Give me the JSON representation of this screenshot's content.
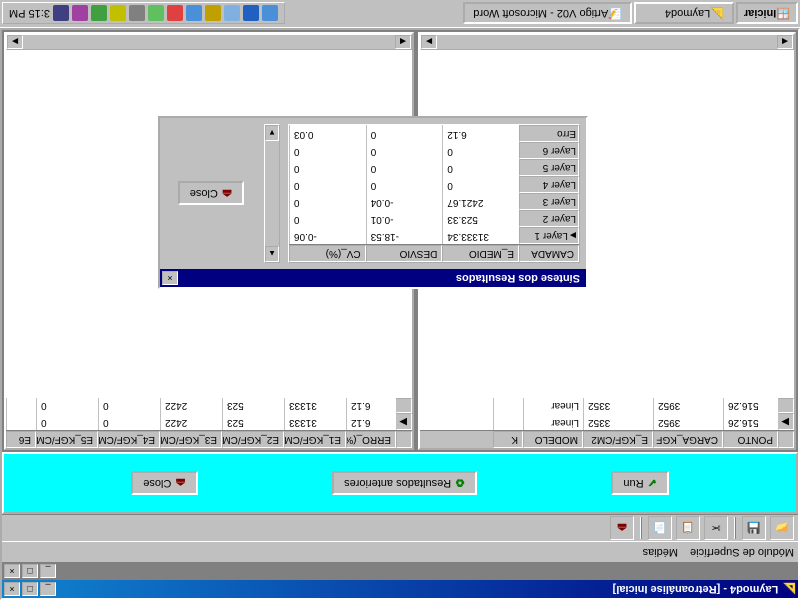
{
  "taskbar": {
    "start": "Iniciar",
    "tasks": [
      {
        "label": "Laymod4",
        "active": true
      },
      {
        "label": "Artigo V02 - Microsoft Word",
        "active": false
      }
    ],
    "clock": "3:15 PM"
  },
  "app": {
    "title": "Laymod4 - [Retroanálise Inicial]",
    "menu": [
      "Módulo de Superfície",
      "Médias"
    ],
    "action_panel": {
      "run": "Run",
      "prev_results": "Resultados anteriores",
      "close": "Close"
    },
    "left_grid": {
      "headers": [
        "PONTO",
        "CARGA_KGF",
        "E_KGF/CM2",
        "MODELO",
        "K"
      ],
      "rows": [
        [
          "516.26",
          "3952",
          "3352",
          "Linear",
          ""
        ],
        [
          "516.26",
          "3952",
          "3352",
          "Linear",
          ""
        ]
      ]
    },
    "right_grid": {
      "headers": [
        "ERRO_(%)",
        "E1_KGF/CM2",
        "E2_KGF/CM2",
        "E3_KGF/CM2",
        "E4_KGF/CM2",
        "E5_KGF/CM2",
        "E6"
      ],
      "rows": [
        [
          "6.12",
          "31333",
          "523",
          "2422",
          "0",
          "0",
          ""
        ],
        [
          "6.12",
          "31333",
          "523",
          "2422",
          "0",
          "0",
          ""
        ]
      ]
    }
  },
  "modal": {
    "title": "Síntese dos Resultados",
    "headers": [
      "CAMADA",
      "E_MEDIO",
      "DESVIO",
      "CV_(%)"
    ],
    "rows": [
      {
        "label": "Layer 1",
        "emedio": "31333.34",
        "desvio": "-18.53",
        "cv": "-0.06",
        "selected": true
      },
      {
        "label": "Layer 2",
        "emedio": "523.33",
        "desvio": "-0.01",
        "cv": "0",
        "selected": false
      },
      {
        "label": "Layer 3",
        "emedio": "2421.67",
        "desvio": "-0.04",
        "cv": "0",
        "selected": false
      },
      {
        "label": "Layer 4",
        "emedio": "0",
        "desvio": "0",
        "cv": "0",
        "selected": false
      },
      {
        "label": "Layer 5",
        "emedio": "0",
        "desvio": "0",
        "cv": "0",
        "selected": false
      },
      {
        "label": "Layer 6",
        "emedio": "0",
        "desvio": "0",
        "cv": "0",
        "selected": false
      },
      {
        "label": "Erro",
        "emedio": "6.12",
        "desvio": "0",
        "cv": "0.03",
        "selected": false
      }
    ],
    "close": "Close"
  }
}
